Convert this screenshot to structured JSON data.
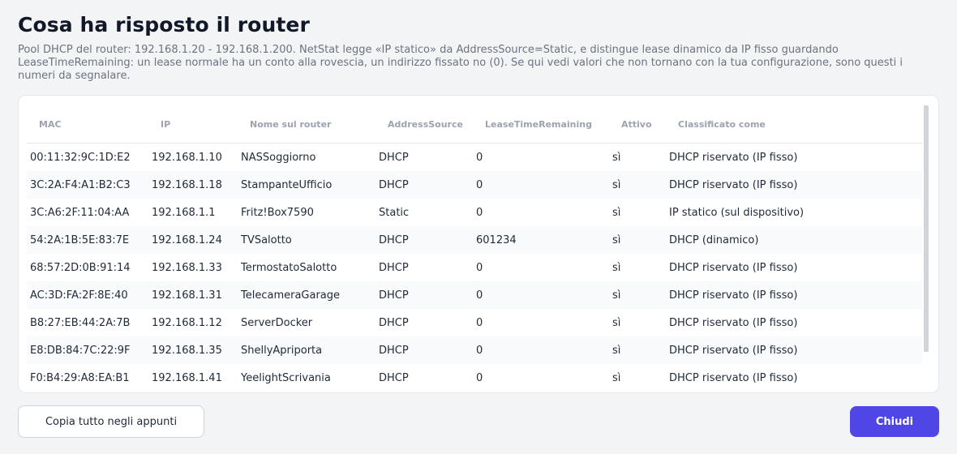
{
  "dialog": {
    "title": "Cosa ha risposto il router",
    "description": "Pool DHCP del router: 192.168.1.20 - 192.168.1.200.  NetStat legge «IP statico» da AddressSource=Static, e distingue lease dinamico da IP fisso guardando LeaseTimeRemaining: un lease normale ha un conto alla rovescia, un indirizzo fissato no (0). Se qui vedi valori che non tornano con la tua configurazione, sono questi i numeri da segnalare."
  },
  "table": {
    "columns": [
      "MAC",
      "IP",
      "Nome sul router",
      "AddressSource",
      "LeaseTimeRemaining",
      "Attivo",
      "Classificato come"
    ],
    "rows": [
      [
        "00:11:32:9C:1D:E2",
        "192.168.1.10",
        "NASSoggiorno",
        "DHCP",
        "0",
        "sì",
        "DHCP riservato (IP fisso)"
      ],
      [
        "3C:2A:F4:A1:B2:C3",
        "192.168.1.18",
        "StampanteUfficio",
        "DHCP",
        "0",
        "sì",
        "DHCP riservato (IP fisso)"
      ],
      [
        "3C:A6:2F:11:04:AA",
        "192.168.1.1",
        "Fritz!Box7590",
        "Static",
        "0",
        "sì",
        "IP statico (sul dispositivo)"
      ],
      [
        "54:2A:1B:5E:83:7E",
        "192.168.1.24",
        "TVSalotto",
        "DHCP",
        "601234",
        "sì",
        "DHCP (dinamico)"
      ],
      [
        "68:57:2D:0B:91:14",
        "192.168.1.33",
        "TermostatoSalotto",
        "DHCP",
        "0",
        "sì",
        "DHCP riservato (IP fisso)"
      ],
      [
        "AC:3D:FA:2F:8E:40",
        "192.168.1.31",
        "TelecameraGarage",
        "DHCP",
        "0",
        "sì",
        "DHCP riservato (IP fisso)"
      ],
      [
        "B8:27:EB:44:2A:7B",
        "192.168.1.12",
        "ServerDocker",
        "DHCP",
        "0",
        "sì",
        "DHCP riservato (IP fisso)"
      ],
      [
        "E8:DB:84:7C:22:9F",
        "192.168.1.35",
        "ShellyApriporta",
        "DHCP",
        "0",
        "sì",
        "DHCP riservato (IP fisso)"
      ],
      [
        "F0:B4:29:A8:EA:B1",
        "192.168.1.41",
        "YeelightScrivania",
        "DHCP",
        "0",
        "sì",
        "DHCP riservato (IP fisso)"
      ]
    ]
  },
  "footer": {
    "copy_label": "Copia tutto negli appunti",
    "close_label": "Chiudi"
  },
  "colors": {
    "primary": "#4f46e5",
    "background": "#f3f4f6",
    "muted_text": "#6b7280"
  }
}
